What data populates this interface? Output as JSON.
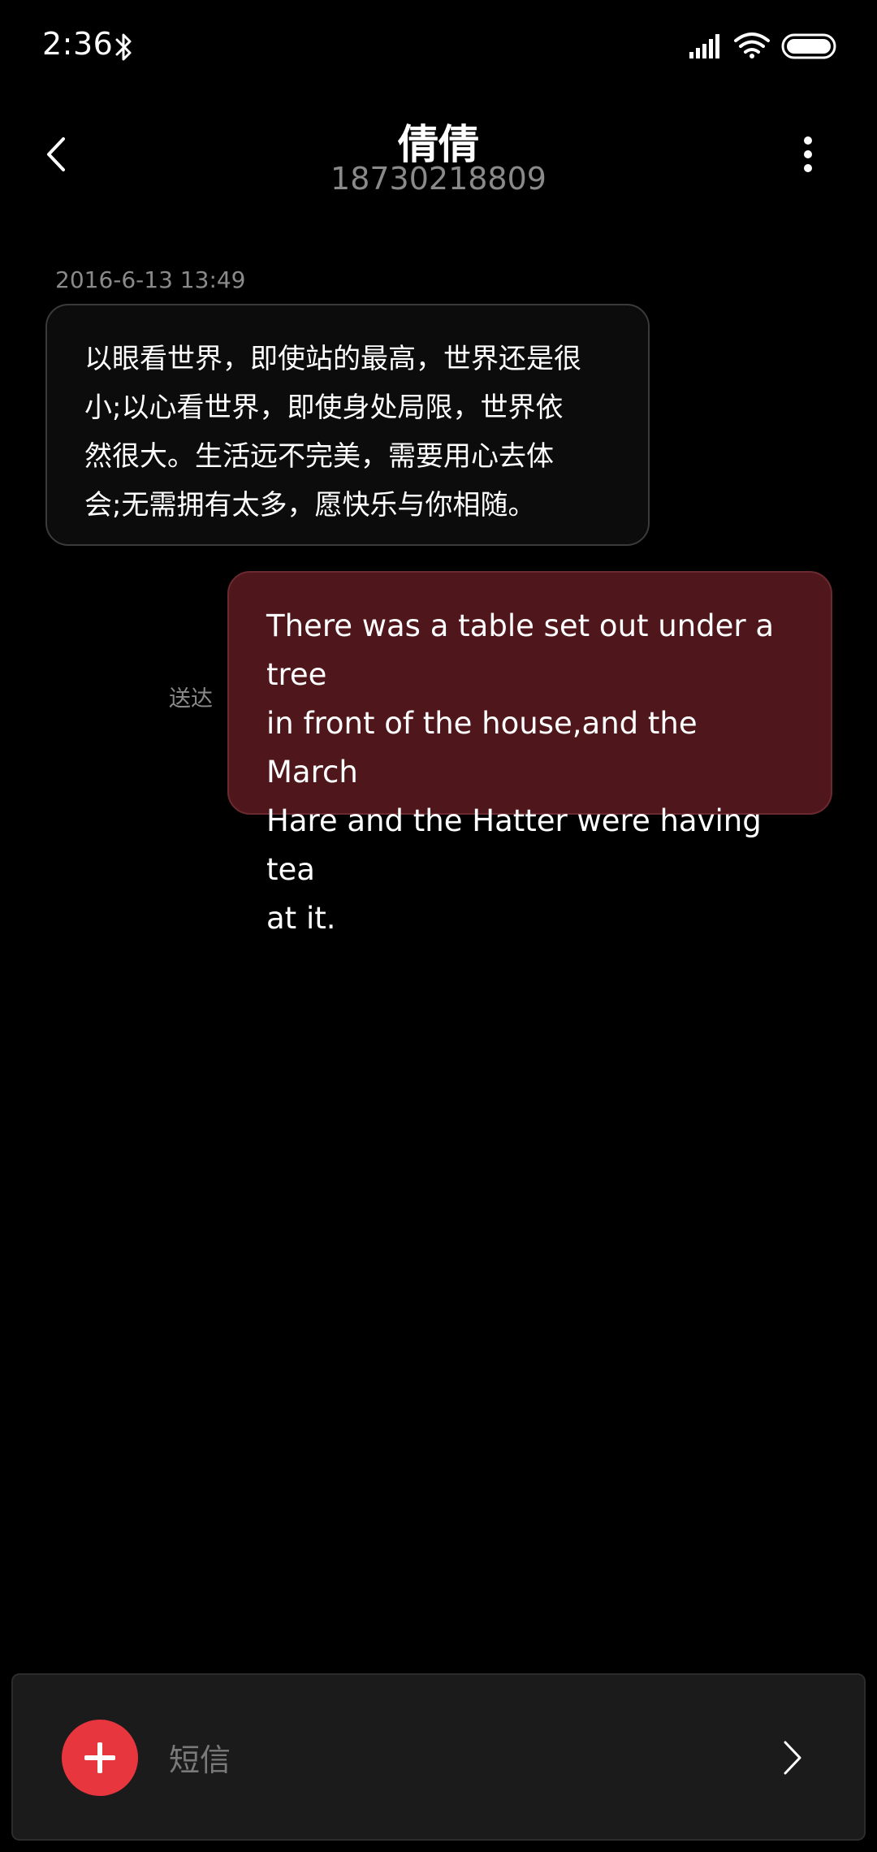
{
  "status_bar": {
    "time": "2:36",
    "icons": [
      "bluetooth-icon",
      "signal-icon",
      "wifi-icon",
      "battery-icon"
    ]
  },
  "header": {
    "contact_name": "倩倩",
    "contact_number": "18730218809",
    "back_icon": "chevron-left-icon",
    "more_icon": "more-vertical-icon"
  },
  "conversation": {
    "timestamp": "2016-6-13 13:49",
    "incoming": {
      "lines": [
        "以眼看世界，即使站的最高，世界还是很",
        "小;以心看世界，即使身处局限，世界依",
        "然很大。生活远不完美，需要用心去体",
        "会;无需拥有太多，愿快乐与你相随。"
      ]
    },
    "outgoing": {
      "lines": [
        "There was a table set out under a tree",
        "in front of the house,and the March",
        "Hare and the Hatter were having tea",
        "at it."
      ],
      "status": "送达"
    }
  },
  "composer": {
    "placeholder": "短信",
    "value": "",
    "add_icon": "plus-icon",
    "send_icon": "chevron-right-icon"
  },
  "colors": {
    "background": "#000000",
    "incoming_bubble": "#0c0c0c",
    "outgoing_bubble": "#4f171c",
    "accent": "#e8363f",
    "secondary_text": "#8a8a8a"
  }
}
